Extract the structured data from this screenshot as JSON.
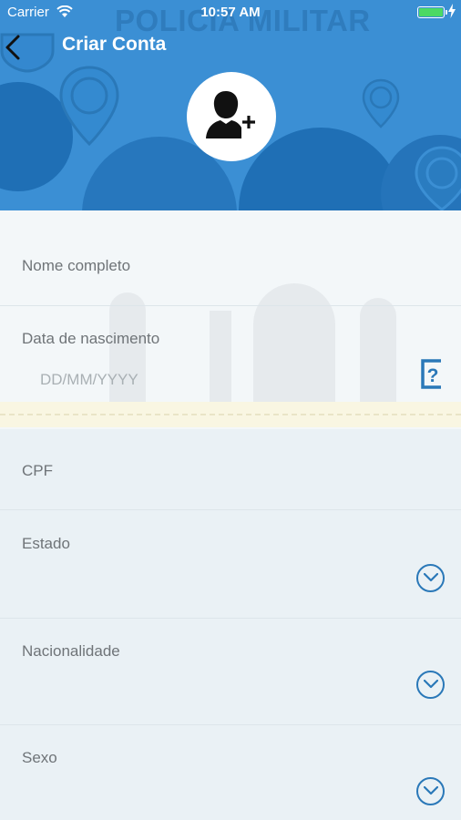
{
  "status_bar": {
    "carrier": "Carrier",
    "time": "10:57 AM"
  },
  "header": {
    "title": "Criar Conta",
    "background_text": "POLICIA MILITAR"
  },
  "form": {
    "nome": {
      "label": "Nome completo"
    },
    "nascimento": {
      "label": "Data de nascimento",
      "placeholder": "DD/MM/YYYY"
    },
    "cpf": {
      "label": "CPF"
    },
    "estado": {
      "label": "Estado"
    },
    "nacionalidade": {
      "label": "Nacionalidade"
    },
    "sexo": {
      "label": "Sexo"
    }
  },
  "colors": {
    "header_blue": "#3b8fd4",
    "accent_blue": "#2a78b8",
    "background": "#eaf1f5"
  },
  "icons": [
    "back-arrow-icon",
    "add-user-icon",
    "help-icon",
    "chevron-down-icon",
    "wifi-icon",
    "battery-icon"
  ]
}
